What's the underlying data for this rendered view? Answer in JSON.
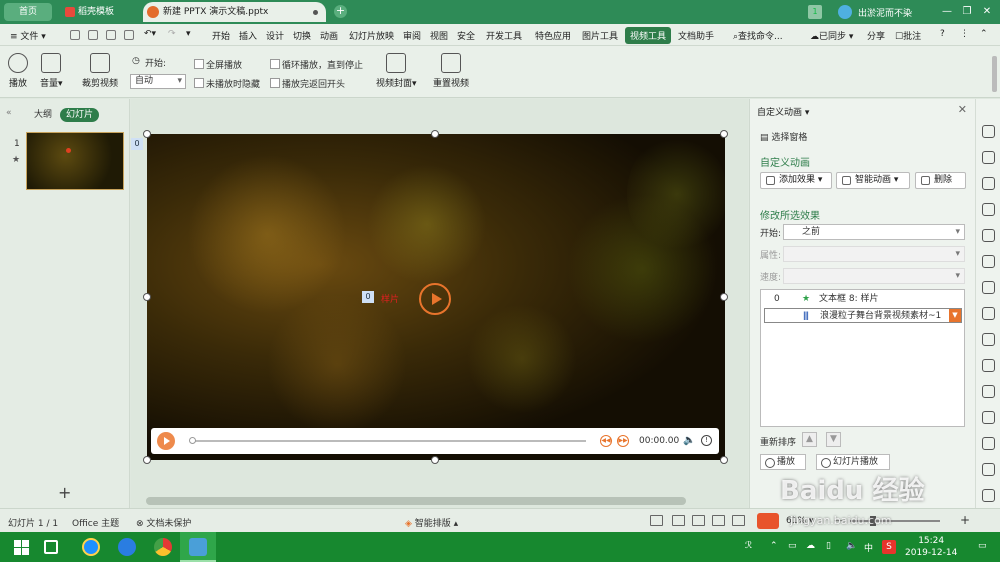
{
  "titlebar": {
    "tabs": [
      "首页",
      "稻壳模板",
      "新建 PPTX 演示文稿.pptx"
    ],
    "badge": "1",
    "user": "出淤泥而不染",
    "window_buttons": [
      "—",
      "❐",
      "✕"
    ]
  },
  "menubar": {
    "file": "文件",
    "items": [
      "开始",
      "插入",
      "设计",
      "切换",
      "动画",
      "幻灯片放映",
      "审阅",
      "视图",
      "安全",
      "开发工具",
      "特色应用",
      "图片工具",
      "视频工具",
      "文档助手"
    ],
    "search": "查找命令...",
    "sync": "已同步",
    "share": "分享",
    "comment": "批注",
    "help": "?"
  },
  "ribbon": {
    "play": "播放",
    "volume": "音量",
    "trim": "裁剪视频",
    "start_label": "开始:",
    "start_value": "自动",
    "fullscreen": "全屏播放",
    "hide_when_not_playing": "未播放时隐藏",
    "loop": "循环播放，直到停止",
    "rewind": "播放完返回开头",
    "cover": "视频封面",
    "reset": "重置视频"
  },
  "left_panel": {
    "tab_outline": "大纲",
    "tab_slides": "幻灯片",
    "slide_number": "1",
    "add": "+"
  },
  "canvas": {
    "anim_tag_1": "0",
    "anim_tag_2": "0",
    "label": "样片",
    "time": "00:00.00"
  },
  "right_panel": {
    "title": "自定义动画",
    "select_pane": "选择窗格",
    "section1": "自定义动画",
    "add_effect": "添加效果",
    "smart_anim": "智能动画",
    "delete": "删除",
    "section2": "修改所选效果",
    "start_label": "开始:",
    "start_value": "之前",
    "prop_label": "属性:",
    "speed_label": "速度:",
    "list": [
      {
        "n": "0",
        "text": "文本框 8: 样片"
      },
      {
        "n": "",
        "text": "浪漫粒子舞台背景视频素材~1"
      }
    ],
    "reorder": "重新排序",
    "play": "播放",
    "slideshow": "幻灯片播放"
  },
  "statusbar": {
    "slide": "幻灯片 1 / 1",
    "theme": "Office 主题",
    "protect": "文档未保护",
    "smart": "智能排版",
    "zoom": "61%",
    "minus": "—",
    "plus": "+"
  },
  "taskbar": {
    "ime": "中",
    "time": "15:24",
    "date": "2019-12-14"
  },
  "watermark": {
    "main": "Baidu 经验",
    "sub": "jingyan.baidu.com"
  },
  "colors": {
    "titlebar": "#2e8b57",
    "accent": "#2e7d4a",
    "play_orange": "#e8742c",
    "taskbar": "#17882f"
  }
}
